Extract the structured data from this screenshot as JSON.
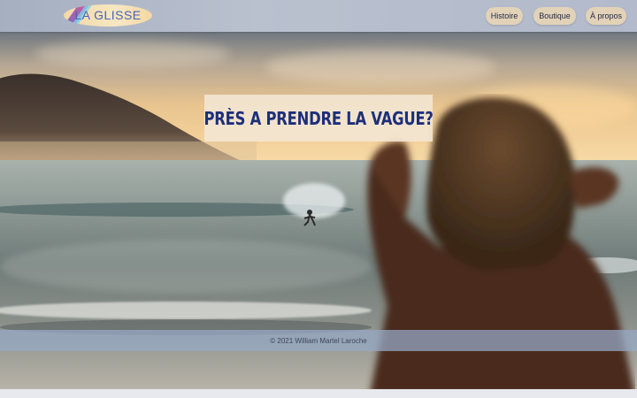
{
  "header": {
    "logo_text": "LA GLISSE",
    "nav": [
      {
        "label": "Histoire"
      },
      {
        "label": "Boutique"
      },
      {
        "label": "À propos"
      }
    ]
  },
  "hero": {
    "headline": "PRÈS A PRENDRE LA VAGUE?"
  },
  "footer": {
    "copyright": "© 2021 William Martel Laroche"
  },
  "colors": {
    "header_bg": "#b2bacb",
    "nav_button_bg": "#e2d2b8",
    "headline": "#1d2f7a",
    "logo_text": "#4a63b8"
  }
}
